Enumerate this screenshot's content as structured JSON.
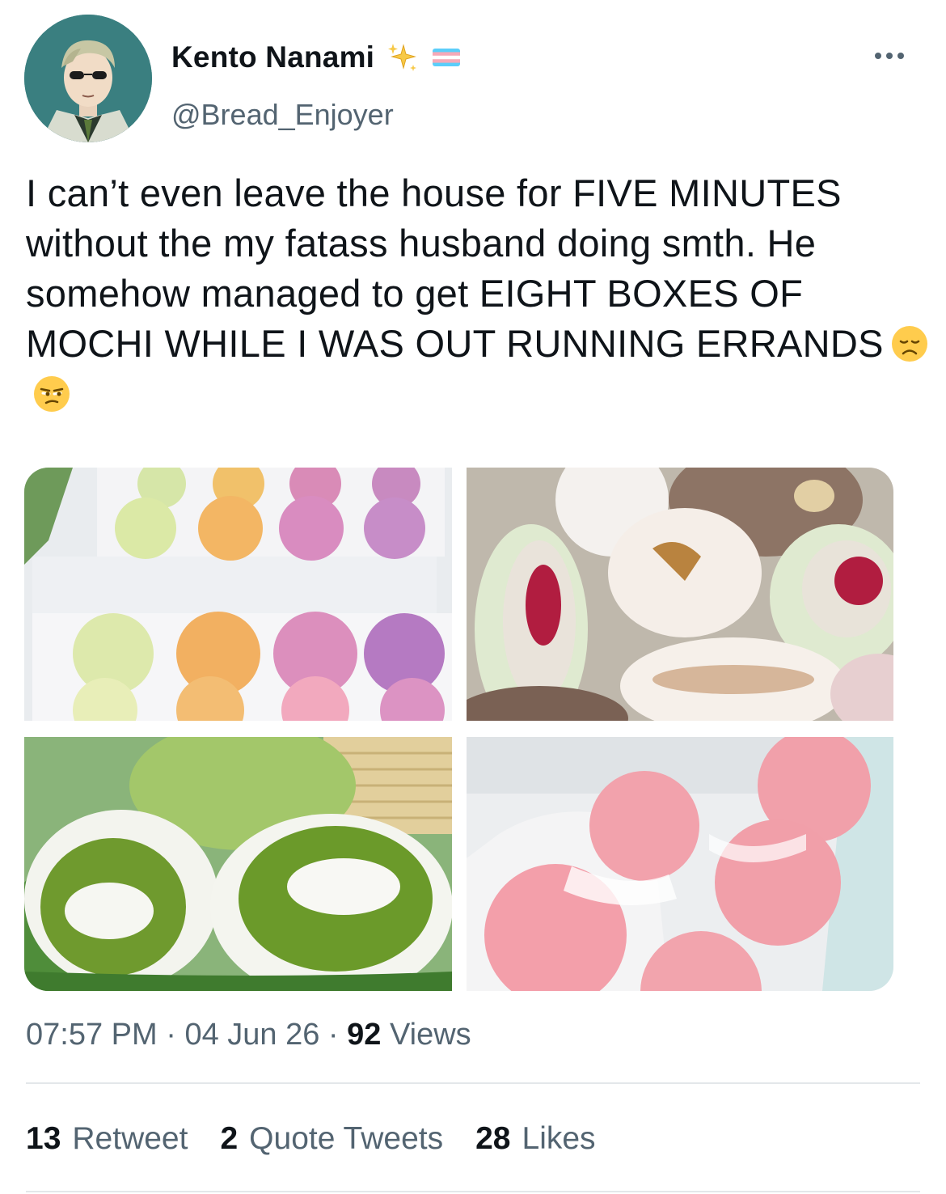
{
  "user": {
    "display_name": "Kento Nanami",
    "handle": "@Bread_Enjoyer",
    "badges": [
      "sparkles-icon",
      "transgender-flag-icon"
    ]
  },
  "header": {
    "more_icon": "more-horizontal-icon"
  },
  "tweet": {
    "text": "I can’t even leave the house for FIVE MINUTES without the my fatass husband doing smth. He somehow managed to get EIGHT BOXES OF MOCHI WHILE I WAS OUT RUNNING ERRANDS",
    "emojis": [
      "disappointed-face-emoji",
      "unamused-face-emoji"
    ]
  },
  "media": {
    "images": [
      "box of pastel mochi",
      "cut mochi with fillings",
      "green matcha mochi halves",
      "pink mochi in paper cups"
    ]
  },
  "meta": {
    "time": "07:57 PM",
    "separator": "·",
    "date": "04 Jun 26",
    "views_count": "92",
    "views_label": "Views"
  },
  "stats": {
    "retweets_count": "13",
    "retweets_label": "Retweet",
    "quotes_count": "2",
    "quotes_label": "Quote Tweets",
    "likes_count": "28",
    "likes_label": "Likes"
  },
  "colors": {
    "text": "#0f1419",
    "secondary": "#536471",
    "divider": "#e3e7ea",
    "flag_blue": "#5bcefa",
    "flag_pink": "#f5a9b8"
  }
}
